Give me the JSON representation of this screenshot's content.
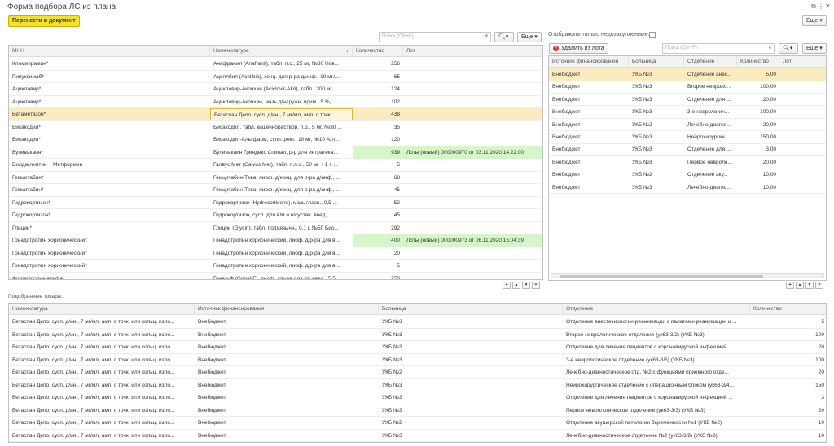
{
  "window": {
    "title": "Форма подбора ЛС из плана",
    "pin_icon": "pin-icon",
    "more_icon": "more-icon",
    "close_icon": "close-icon"
  },
  "toolbar": {
    "transfer_button": "Перенести в документ",
    "more_button": "Еще"
  },
  "left": {
    "search_placeholder": "Поиск (Ctrl+F)",
    "more_button": "Еще",
    "columns": [
      "МНН",
      "Номенклатура",
      "Количество",
      "Лот"
    ],
    "rows": [
      {
        "mnn": "Кломипрамин*",
        "nom": "Анафранил (Anafranil), табл. п.о., 25 мг, №30 Нов...",
        "qty": "256",
        "lot": ""
      },
      {
        "mnn": "Рипуксимаб*",
        "nom": "Ацеллбия (Acellbia), конц. для р-ра д/инф., 10 мг/...",
        "qty": "65",
        "lot": ""
      },
      {
        "mnn": "Ацикловир*",
        "nom": "Ацикловир-Акрихин (Aciclovir-Akri), табл., 200 мг, ...",
        "qty": "124",
        "lot": ""
      },
      {
        "mnn": "Ацикловир*",
        "nom": "Ацикловир-Акрихин, мазь д/наружн. прим., 5 %, ...",
        "qty": "102",
        "lot": ""
      },
      {
        "mnn": "Бетаметазон*",
        "nom": "Бетаспан Депо, сусп. д/ин., 7 мг/мл, амп. с точк. ...",
        "qty": "438",
        "lot": ""
      },
      {
        "mnn": "Бисакодил*",
        "nom": "Бисакодил, табл. кишечнораствор. п.о., 5 мг, №30 ...",
        "qty": "35",
        "lot": ""
      },
      {
        "mnn": "Бисакодил*",
        "nom": "Бисакодил-Альтфарм, супп. рект., 10 мг, №10 Алт...",
        "qty": "120",
        "lot": ""
      },
      {
        "mnn": "Бупивакаин*",
        "nom": "Бупивакаин Гриндекс Спинал, р-р для интратека...",
        "qty": "939",
        "lot": "Лоты (новый) 000000970 от 03.11.2020 14:22:00"
      },
      {
        "mnn": "Вилдаглиптин + Метформин",
        "nom": "Галвус Мет (Galvus Met), табл. п.п.о., 50 мг + 1 г, ...",
        "qty": "5",
        "lot": ""
      },
      {
        "mnn": "Гемцитабин*",
        "nom": "Гемцитабин-Тева, лиоф. д/конц. для р-ра д/инф., ...",
        "qty": "68",
        "lot": ""
      },
      {
        "mnn": "Гемцитабин*",
        "nom": "Гемцитабин-Тева, лиоф. д/конц. для р-ра д/инф., ...",
        "qty": "45",
        "lot": ""
      },
      {
        "mnn": "Гидрокортизон*",
        "nom": "Гидрокортизон (Hydrocortisone), мазь глазн., 0,5 ...",
        "qty": "52",
        "lot": ""
      },
      {
        "mnn": "Гидрокортизон*",
        "nom": "Гидрокортизон, сусп. для в/м и в/сустав. введ., ...",
        "qty": "45",
        "lot": ""
      },
      {
        "mnn": "Глицин*",
        "nom": "Глицин (Glycin), табл. подъязычн., 0,1 г, №50 Био...",
        "qty": "292",
        "lot": ""
      },
      {
        "mnn": "Гонадотропин хорионический*",
        "nom": "Гонадотропин хорионический, лиоф. д/р-ра для в...",
        "qty": "400",
        "lot": "Лоты (новый) 000000973 от 06.11.2020 15:04:39"
      },
      {
        "mnn": "Гонадотропин хорионический*",
        "nom": "Гонадотропин хорионический, лиоф. д/р-ра для в...",
        "qty": "20",
        "lot": ""
      },
      {
        "mnn": "Гонадотропин хорионический*",
        "nom": "Гонадотропин хорионический, лиоф. д/р-ра для в...",
        "qty": "5",
        "lot": ""
      },
      {
        "mnn": "Фоллитропин альфа*",
        "nom": "Гонал-Ф (Gonal-F), лиоф. д/р-ра для п/к введ., 5,5...",
        "qty": "750",
        "lot": ""
      }
    ]
  },
  "right": {
    "show_only_label": "Отображать только недозакупленные:",
    "delete_button": "Удалить из лота",
    "search_placeholder": "Поиск (Ctrl+F)",
    "more_button": "Еще",
    "columns": [
      "Источник финансирования",
      "Больница",
      "Отделение",
      "Количество",
      "Лот"
    ],
    "rows": [
      {
        "src": "Внебюджет",
        "hosp": "УКБ №3",
        "dept": "Отделение анес...",
        "qty": "5,00"
      },
      {
        "src": "Внебюджет",
        "hosp": "УКБ №3",
        "dept": "Второе невроло...",
        "qty": "100,00"
      },
      {
        "src": "Внебюджет",
        "hosp": "УКБ №3",
        "dept": "Отделение для ...",
        "qty": "20,00"
      },
      {
        "src": "Внебюджет",
        "hosp": "УКБ №3",
        "dept": "3-е неврологич...",
        "qty": "100,00"
      },
      {
        "src": "Внебюджет",
        "hosp": "УКБ №2",
        "dept": "Лечебно-диагно...",
        "qty": "20,00"
      },
      {
        "src": "Внебюджет",
        "hosp": "УКБ №3",
        "dept": "Нейрохирургич...",
        "qty": "150,00"
      },
      {
        "src": "Внебюджет",
        "hosp": "УКБ №3",
        "dept": "Отделение для ...",
        "qty": "3,00"
      },
      {
        "src": "Внебюджет",
        "hosp": "УКБ №3",
        "dept": "Первое невроло...",
        "qty": "20,00"
      },
      {
        "src": "Внебюджет",
        "hosp": "УКБ №2",
        "dept": "Отделение аку...",
        "qty": "10,00"
      },
      {
        "src": "Внебюджет",
        "hosp": "УКБ №3",
        "dept": "Лечебно-диагно...",
        "qty": "10,00"
      }
    ]
  },
  "bottom": {
    "label": "Подобранные товары:",
    "columns": [
      "Номенклатура",
      "Источник финансирования",
      "Больница",
      "Отделение",
      "Количество"
    ],
    "rows": [
      {
        "nom": "Бетаспан Депо, сусп. д/ин., 7 мг/мл, амп. с точк. или кольц. изло...",
        "src": "Внебюджет",
        "hosp": "УКБ №3",
        "dept": "Отделение анестезиологии-реанимации с палатами реанимации и ...",
        "qty": "5"
      },
      {
        "nom": "Бетаспан Депо, сусп. д/ин., 7 мг/мл, амп. с точк. или кольц. изло...",
        "src": "Внебюджет",
        "hosp": "УКБ №3",
        "dept": "Второе неврологическое отделение (ук63-3/2) (УКБ №3)",
        "qty": "100"
      },
      {
        "nom": "Бетаспан Депо, сусп. д/ин., 7 мг/мл, амп. с точк. или кольц. изло...",
        "src": "Внебюджет",
        "hosp": "УКБ №3",
        "dept": "Отделение для лечения пациентов с коронавирусной инфекцией ...",
        "qty": "20"
      },
      {
        "nom": "Бетаспан Депо, сусп. д/ин., 7 мг/мл, амп. с точк. или кольц. изло...",
        "src": "Внебюджет",
        "hosp": "УКБ №3",
        "dept": "3-е неврологическое отделение (ук63-3/5) (УКБ №3)",
        "qty": "100"
      },
      {
        "nom": "Бетаспан Депо, сусп. д/ин., 7 мг/мл, амп. с точк. или кольц. изло...",
        "src": "Внебюджет",
        "hosp": "УКБ №2",
        "dept": "Лечебно-диагностическое отд. №2 с функциями приемного отде...",
        "qty": "20"
      },
      {
        "nom": "Бетаспан Депо, сусп. д/ин., 7 мг/мл, амп. с точк. или кольц. изло...",
        "src": "Внебюджет",
        "hosp": "УКБ №3",
        "dept": "Нейрохирургическое отделение с операционным блоком (ук63-3/4...",
        "qty": "150"
      },
      {
        "nom": "Бетаспан Депо, сусп. д/ин., 7 мг/мл, амп. с точк. или кольц. изло...",
        "src": "Внебюджет",
        "hosp": "УКБ №3",
        "dept": "Отделение для лечения пациентов с коронавирусной инфекцией ...",
        "qty": "3"
      },
      {
        "nom": "Бетаспан Депо, сусп. д/ин., 7 мг/мл, амп. с точк. или кольц. изло...",
        "src": "Внебюджет",
        "hosp": "УКБ №3",
        "dept": "Первое неврологическое отделение (ук63-3/3) (УКБ №3)",
        "qty": "20"
      },
      {
        "nom": "Бетаспан Депо, сусп. д/ин., 7 мг/мл, амп. с точк. или кольц. изло...",
        "src": "Внебюджет",
        "hosp": "УКБ №2",
        "dept": "Отделение акушерской патологии беременности №1 (УКБ №2)",
        "qty": "10"
      },
      {
        "nom": "Бетаспан Депо, сусп. д/ин., 7 мг/мл, амп. с точк. или кольц. изло...",
        "src": "Внебюджет",
        "hosp": "УКБ №3",
        "dept": "Лечебно-диагностическое отделение №2 (ук63-3/9) (УКБ №3)",
        "qty": "10"
      }
    ]
  },
  "colors": {
    "accent_yellow": "#f6e12a",
    "selected_row": "#fbecc0",
    "lot_green": "#d6f5c8"
  }
}
